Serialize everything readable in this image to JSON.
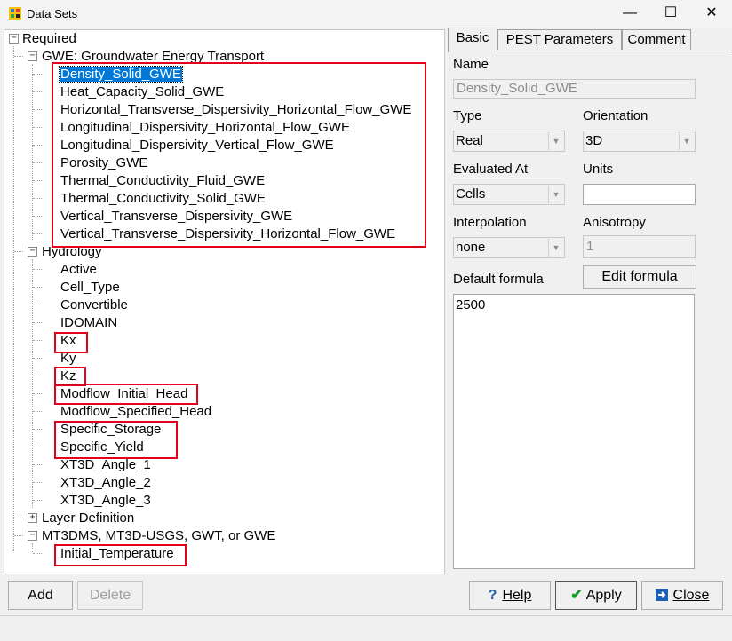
{
  "window": {
    "title": "Data Sets",
    "minimize": "—",
    "maximize": "☐",
    "close": "✕"
  },
  "tree": {
    "root": "Required",
    "gwe_group": "GWE: Groundwater Energy Transport",
    "gwe_items": [
      "Density_Solid_GWE",
      "Heat_Capacity_Solid_GWE",
      "Horizontal_Transverse_Dispersivity_Horizontal_Flow_GWE",
      "Longitudinal_Dispersivity_Horizontal_Flow_GWE",
      "Longitudinal_Dispersivity_Vertical_Flow_GWE",
      "Porosity_GWE",
      "Thermal_Conductivity_Fluid_GWE",
      "Thermal_Conductivity_Solid_GWE",
      "Vertical_Transverse_Dispersivity_GWE",
      "Vertical_Transverse_Dispersivity_Horizontal_Flow_GWE"
    ],
    "hydrology_group": "Hydrology",
    "hydrology_items": [
      "Active",
      "Cell_Type",
      "Convertible",
      "IDOMAIN",
      "Kx",
      "Ky",
      "Kz",
      "Modflow_Initial_Head",
      "Modflow_Specified_Head",
      "Specific_Storage",
      "Specific_Yield",
      "XT3D_Angle_1",
      "XT3D_Angle_2",
      "XT3D_Angle_3"
    ],
    "layer_group": "Layer Definition",
    "mt3d_group": "MT3DMS, MT3D-USGS, GWT, or GWE",
    "mt3d_items": [
      "Initial_Temperature"
    ],
    "expanded_glyph": "−",
    "collapsed_glyph": "+"
  },
  "tabs": [
    "Basic",
    "PEST Parameters",
    "Comment"
  ],
  "basic": {
    "name_label": "Name",
    "name_value": "Density_Solid_GWE",
    "type_label": "Type",
    "type_value": "Real",
    "orientation_label": "Orientation",
    "orientation_value": "3D",
    "evaluated_label": "Evaluated At",
    "evaluated_value": "Cells",
    "units_label": "Units",
    "units_value": "",
    "interpolation_label": "Interpolation",
    "interpolation_value": "none",
    "anisotropy_label": "Anisotropy",
    "anisotropy_value": "1",
    "default_formula_label": "Default formula",
    "edit_formula_label": "Edit formula",
    "formula_value": "2500"
  },
  "buttons": {
    "add": "Add",
    "delete": "Delete",
    "help": "Help",
    "apply": "Apply",
    "close": "Close"
  },
  "colors": {
    "selection": "#0078d7",
    "highlight_box": "#e2001a",
    "apply_check": "#1a9b2e",
    "help_icon": "#1f5fb4",
    "close_icon": "#1f5fb4"
  }
}
